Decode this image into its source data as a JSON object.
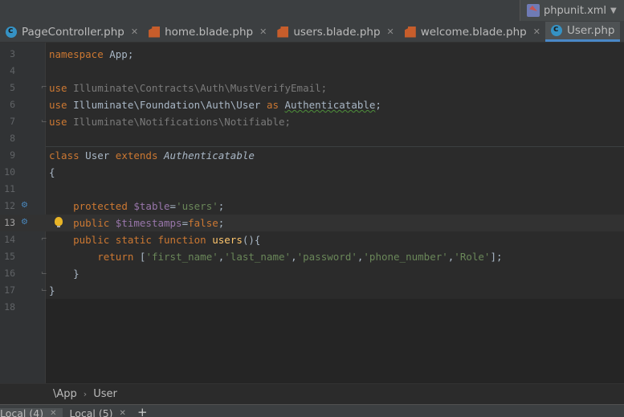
{
  "run_config": {
    "label": "phpunit.xml",
    "icon": "php-file-icon"
  },
  "tabs": [
    {
      "label": "PageController.php",
      "icon": "php-class-icon",
      "active": false
    },
    {
      "label": "home.blade.php",
      "icon": "blade-icon",
      "active": false
    },
    {
      "label": "users.blade.php",
      "icon": "blade-icon",
      "active": false
    },
    {
      "label": "welcome.blade.php",
      "icon": "blade-icon",
      "active": false
    },
    {
      "label": "User.php",
      "icon": "php-class-icon",
      "active": true
    }
  ],
  "editor": {
    "current_line": 13,
    "lines": [
      {
        "n": "3"
      },
      {
        "n": "4"
      },
      {
        "n": "5"
      },
      {
        "n": "6"
      },
      {
        "n": "7"
      },
      {
        "n": "8"
      },
      {
        "n": "9"
      },
      {
        "n": "10"
      },
      {
        "n": "11"
      },
      {
        "n": "12"
      },
      {
        "n": "13"
      },
      {
        "n": "14"
      },
      {
        "n": "15"
      },
      {
        "n": "16"
      },
      {
        "n": "17"
      },
      {
        "n": "18"
      }
    ],
    "code": {
      "l3": {
        "kw": "namespace",
        "rest": " App;"
      },
      "l5": {
        "kw": "use",
        "path": " Illuminate\\Contracts\\Auth\\MustVerifyEmail;"
      },
      "l6": {
        "kw": "use",
        "path": " Illuminate\\Foundation\\Auth\\User ",
        "as": "as",
        "alias": "Authenticatable",
        "end": ";"
      },
      "l7": {
        "kw": "use",
        "path": " Illuminate\\Notifications\\Notifiable;"
      },
      "l9": {
        "kw": "class",
        "name": " User ",
        "ext": "extends",
        "parent": "Authenticatable"
      },
      "l10": {
        "text": "{"
      },
      "l12": {
        "kw": "protected",
        "var": "$table",
        "eq": "=",
        "str": "'users'",
        "end": ";"
      },
      "l13": {
        "kw": "public",
        "var": "$timestamps",
        "eq": "=",
        "val": "false",
        "end": ";"
      },
      "l14": {
        "kw": "public static function",
        "fn": "users",
        "end": "(){"
      },
      "l15": {
        "kw": "return",
        "open": " [",
        "s1": "'first_name'",
        "s2": "'last_name'",
        "s3": "'password'",
        "s4": "'phone_number'",
        "s5": "'Role'",
        "comma": ",",
        "close": "];"
      },
      "l16": {
        "text": "}"
      },
      "l17": {
        "text": "}"
      }
    }
  },
  "breadcrumb": {
    "items": [
      "\\App",
      "User"
    ]
  },
  "bottom_tabs": [
    {
      "label": "Local (4)"
    },
    {
      "label": "Local (5)"
    }
  ],
  "bottom_plus": "+"
}
